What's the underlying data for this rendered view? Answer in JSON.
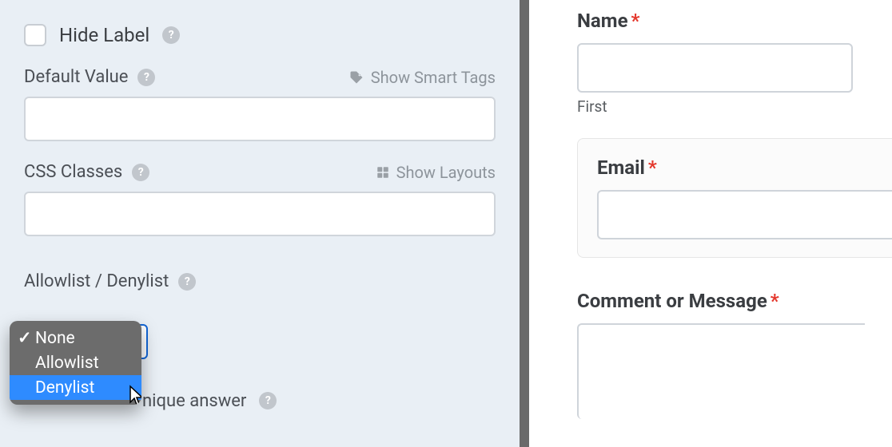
{
  "leftPanel": {
    "hideLabel": {
      "label": "Hide Label"
    },
    "defaultValue": {
      "label": "Default Value",
      "showSmartTags": "Show Smart Tags",
      "value": ""
    },
    "cssClasses": {
      "label": "CSS Classes",
      "showLayouts": "Show Layouts",
      "value": ""
    },
    "allowDeny": {
      "label": "Allowlist / Denylist",
      "options": [
        "None",
        "Allowlist",
        "Denylist"
      ],
      "selected": "None",
      "highlighted": "Denylist"
    },
    "uniqueAnswer": {
      "visibleText": "nique answer"
    }
  },
  "rightPanel": {
    "name": {
      "label": "Name",
      "required": true,
      "value": "",
      "sublabel": "First"
    },
    "email": {
      "label": "Email",
      "required": true,
      "value": ""
    },
    "comment": {
      "label": "Comment or Message",
      "required": true,
      "value": ""
    }
  },
  "glyphs": {
    "requiredStar": "*",
    "checkmark": "✓",
    "questionMark": "?"
  }
}
